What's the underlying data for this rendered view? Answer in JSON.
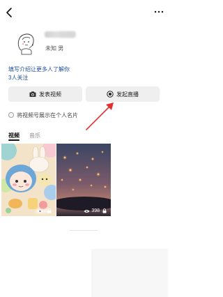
{
  "profile": {
    "gender_line": "未知 男",
    "bio_prompt": "填写介绍让更多人了解你",
    "follow_count": "3人关注"
  },
  "actions": {
    "post_video": "发表视频",
    "start_live": "发起直播"
  },
  "show_on_card": "将视频号展示在个人名片",
  "tabs": [
    "视频",
    "音乐"
  ],
  "videos": [
    {
      "views": ""
    },
    {
      "views": "398"
    }
  ],
  "colors": {
    "link": "#1d4f9c",
    "button_bg": "#efefef",
    "annotation_arrow": "#e0312f"
  },
  "icons": {
    "back": "chevron-left-icon",
    "more": "more-dots-icon",
    "camera": "camera-icon",
    "live": "live-record-icon",
    "eye": "eye-icon",
    "lock": "lock-icon"
  }
}
